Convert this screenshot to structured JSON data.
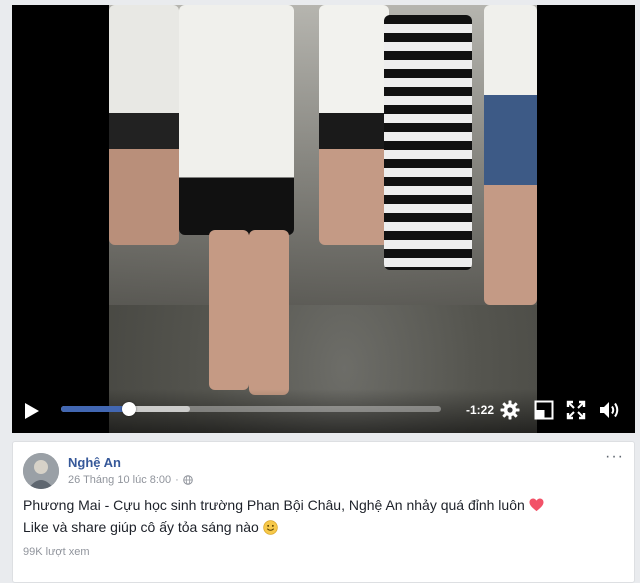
{
  "player": {
    "time_remaining": "-1:22",
    "progress_played": 0.18,
    "progress_buffered": 0.34,
    "accent_color": "#4267b2",
    "icons": [
      "play-icon",
      "settings-icon",
      "pip-icon",
      "fullscreen-icon",
      "volume-icon"
    ]
  },
  "post": {
    "author": "Nghệ An",
    "timestamp": "26 Tháng 10 lúc 8:00",
    "privacy_icon": "globe-icon",
    "line1": "Phương Mai - Cựu học sinh trường Phan Bội Châu, Nghệ An nhảy quá đỉnh luôn",
    "line1_emoji": "heart-icon",
    "line2": "Like và share giúp cô ấy tỏa sáng nào",
    "line2_emoji": "smile-icon",
    "views": "99K lượt xem",
    "more_label": "···"
  }
}
